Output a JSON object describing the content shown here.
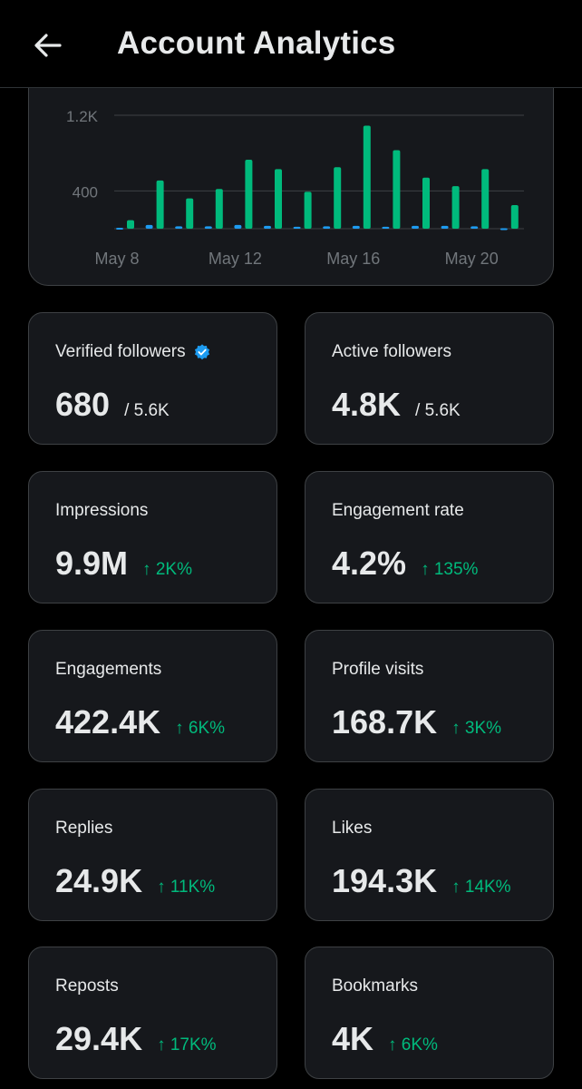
{
  "header": {
    "title": "Account Analytics",
    "back_icon": "arrow-left-icon"
  },
  "colors": {
    "background": "#000000",
    "card": "#16181c",
    "card_border": "#3e4144",
    "positive": "#00ba7c",
    "accent_blue": "#1d9bf0",
    "text": "#e7e9ea",
    "muted": "#71767b"
  },
  "chart_data": {
    "type": "bar",
    "categories": [
      "May 8",
      "May 9",
      "May 10",
      "May 11",
      "May 12",
      "May 13",
      "May 14",
      "May 15",
      "May 16",
      "May 17",
      "May 18",
      "May 19",
      "May 20",
      "May 21"
    ],
    "x_tick_labels": [
      "May 8",
      "May 12",
      "May 16",
      "May 20"
    ],
    "y_tick_labels": [
      "1.2K",
      "400"
    ],
    "ylim": [
      0,
      1200
    ],
    "grid": true,
    "series": [
      {
        "color": "#1d9bf0",
        "values": [
          10,
          40,
          25,
          25,
          40,
          30,
          20,
          25,
          30,
          20,
          30,
          30,
          25,
          5
        ]
      },
      {
        "color": "#00ba7c",
        "values": [
          90,
          510,
          320,
          420,
          730,
          630,
          390,
          650,
          1090,
          830,
          540,
          450,
          630,
          250
        ]
      }
    ],
    "title": "",
    "xlabel": "",
    "ylabel": ""
  },
  "stats": [
    {
      "label": "Verified followers",
      "value": "680",
      "total": "/ 5.6K",
      "verified_badge": true
    },
    {
      "label": "Active followers",
      "value": "4.8K",
      "total": "/ 5.6K"
    },
    {
      "label": "Impressions",
      "value": "9.9M",
      "change": "↑ 2K%"
    },
    {
      "label": "Engagement rate",
      "value": "4.2%",
      "change": "↑ 135%"
    },
    {
      "label": "Engagements",
      "value": "422.4K",
      "change": "↑ 6K%"
    },
    {
      "label": "Profile visits",
      "value": "168.7K",
      "change": "↑ 3K%"
    },
    {
      "label": "Replies",
      "value": "24.9K",
      "change": "↑ 11K%"
    },
    {
      "label": "Likes",
      "value": "194.3K",
      "change": "↑ 14K%"
    },
    {
      "label": "Reposts",
      "value": "29.4K",
      "change": "↑ 17K%"
    },
    {
      "label": "Bookmarks",
      "value": "4K",
      "change": "↑ 6K%"
    }
  ]
}
